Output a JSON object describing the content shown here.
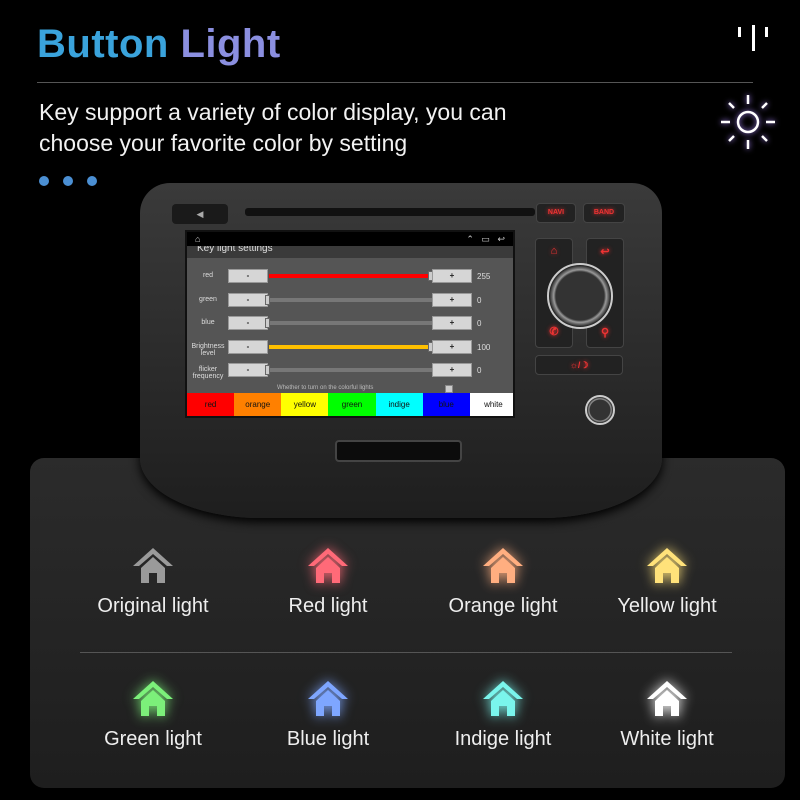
{
  "header": {
    "title_part1": "Button",
    "title_part2": "Light",
    "subtitle_line1": "Key support a variety of color display, you can",
    "subtitle_line2": "choose your favorite color by setting",
    "title_colors": [
      "#3aa3dc",
      "#8b8fe0"
    ]
  },
  "head_unit": {
    "buttons": {
      "navi": "NAVI",
      "band": "BAND"
    },
    "screen": {
      "title": "Key light settings",
      "rows": [
        {
          "label": "red",
          "value": "255",
          "level": 1.0,
          "color": "#ff0000"
        },
        {
          "label": "green",
          "value": "0",
          "level": 0,
          "color": "#888888"
        },
        {
          "label": "blue",
          "value": "0",
          "level": 0,
          "color": "#888888"
        },
        {
          "label": "Brightness level",
          "value": "100",
          "level": 1.0,
          "color": "#ffc000"
        },
        {
          "label": "flicker frequency",
          "value": "0",
          "level": 0,
          "color": "#888888"
        }
      ],
      "minus": "-",
      "plus": "+",
      "hint": "Whether to turn on the colorful lights",
      "colors": [
        {
          "label": "red",
          "hex": "#ff0000"
        },
        {
          "label": "orange",
          "hex": "#ff8000"
        },
        {
          "label": "yellow",
          "hex": "#ffff00"
        },
        {
          "label": "green",
          "hex": "#00ff00"
        },
        {
          "label": "indige",
          "hex": "#00ffff"
        },
        {
          "label": "blue",
          "hex": "#0000ff"
        },
        {
          "label": "white",
          "hex": "#ffffff"
        }
      ]
    }
  },
  "lights": [
    {
      "label": "Original light",
      "color": "#9a9a9a"
    },
    {
      "label": "Red light",
      "color": "#ff6a78"
    },
    {
      "label": "Orange light",
      "color": "#ffae80"
    },
    {
      "label": "Yellow light",
      "color": "#ffe27a"
    },
    {
      "label": "Green light",
      "color": "#7cf07a"
    },
    {
      "label": "Blue light",
      "color": "#7ea6ff"
    },
    {
      "label": "Indige light",
      "color": "#7af5ec"
    },
    {
      "label": "White light",
      "color": "#ffffff"
    }
  ]
}
